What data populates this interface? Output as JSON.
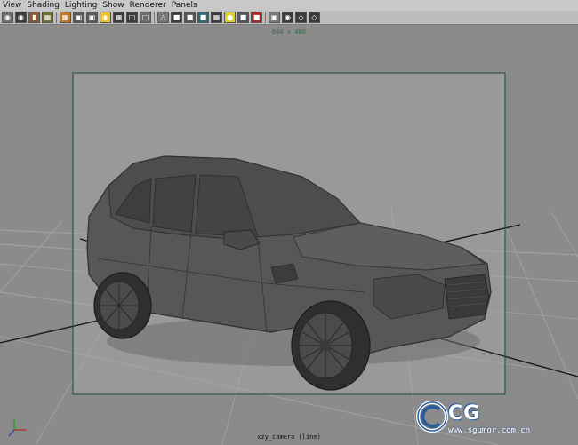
{
  "menubar": {
    "items": [
      "View",
      "Shading",
      "Lighting",
      "Show",
      "Renderer",
      "Panels"
    ]
  },
  "toolbar": {
    "icons": [
      "select-camera-icon",
      "camera-attributes-icon",
      "bookmark-icon",
      "image-plane-icon",
      "grid-icon",
      "film-gate-icon",
      "resolution-gate-icon",
      "gate-mask-icon",
      "field-chart-icon",
      "safe-action-icon",
      "safe-title-icon",
      "wireframe-icon",
      "smooth-shade-icon",
      "default-material-icon",
      "shaded-wire-icon",
      "textured-icon",
      "lights-icon",
      "shadows-icon",
      "high-quality-icon",
      "isolate-select-icon",
      "xray-icon",
      "xray-joints-icon",
      "backface-icon"
    ]
  },
  "viewport": {
    "resolution_label": "640 x 480",
    "camera_label": "xzy_camera (line)",
    "background_color": "#8f8f8f",
    "gate_border_color": "#2f5a3e",
    "grid_color": "#a6a6a6"
  },
  "watermark": {
    "logo_text": "CG",
    "url": "www.sgumor.com.cn"
  },
  "colors": {
    "menubar_bg": "#c8c8c8",
    "toolbar_bg": "#bdbdbd",
    "car_body": "#555555",
    "car_dark": "#3a3a3a"
  }
}
